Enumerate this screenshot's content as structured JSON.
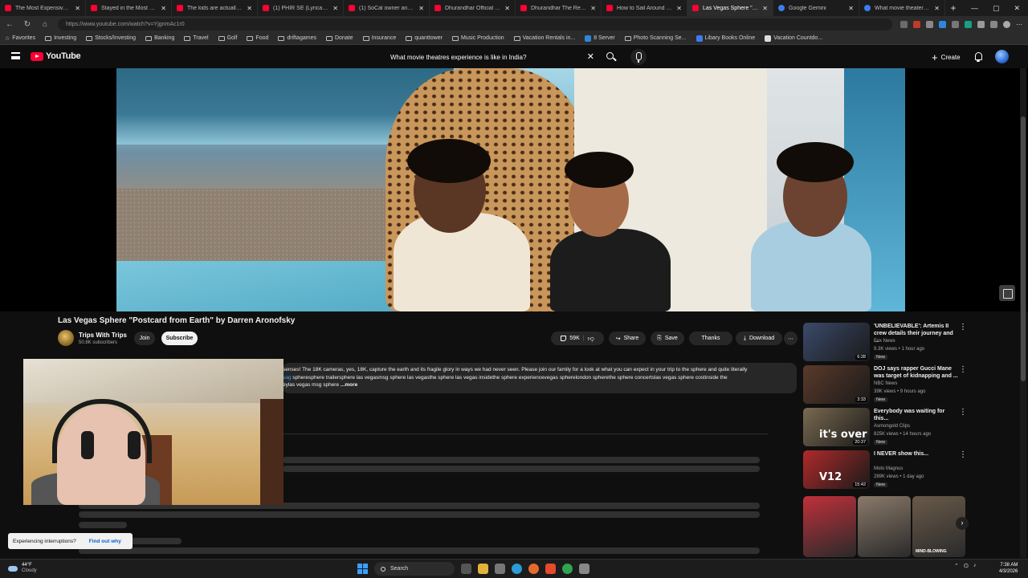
{
  "browser": {
    "tabs": [
      {
        "title": "The Most Expensive Mistak...",
        "favicon": "youtube-icon"
      },
      {
        "title": "Stayed in the Most Dangero...",
        "favicon": "youtube-icon"
      },
      {
        "title": "The kids are actually noticing...",
        "favicon": "youtube-icon"
      },
      {
        "title": "(1) PHIR SE (Lyrical) Dhuran...",
        "favicon": "youtube-icon"
      },
      {
        "title": "(1) SoCal owner and missing...",
        "favicon": "youtube-icon"
      },
      {
        "title": "Dhurandhar Official Trailer |...",
        "favicon": "youtube-icon"
      },
      {
        "title": "Dhurandhar The Revenge Of...",
        "favicon": "youtube-icon"
      },
      {
        "title": "How to Sail Around The Wo...",
        "favicon": "youtube-icon"
      },
      {
        "title": "Las Vegas Sphere \"Postcard...",
        "favicon": "youtube-icon",
        "active": true
      },
      {
        "title": "Google Gemini",
        "favicon": "gemini-icon"
      },
      {
        "title": "What movie theater experie...",
        "favicon": "google-icon"
      }
    ],
    "url": "https://www.youtube.com/watch?v=YjgnmAc1r0",
    "bookmarks": [
      "Favorites",
      "Investing",
      "Stocks/Investing",
      "Banking",
      "Travel",
      "Golf",
      "Food",
      "driftagames",
      "Donate",
      "Insurance",
      "quanttower",
      "Music Production",
      "Vacation Rentals in...",
      "8 Server",
      "Photo Scanning Se...",
      "Libary Books Online",
      "Vacation Countdo..."
    ]
  },
  "youtube": {
    "logo_text": "YouTube",
    "search_value": "What movie theatres experience is like in India?",
    "create_label": "Create",
    "video_title": "Las Vegas Sphere \"Postcard from Earth\" by Darren Aronofsky",
    "channel_name": "Trips With Trips",
    "channel_subs": "50.8K subscribers",
    "join_label": "Join",
    "subscribe_label": "Subscribe",
    "like_count": "59K",
    "share_label": "Share",
    "save_label": "Save",
    "thanks_label": "Thanks",
    "download_label": "Download",
    "description_line1": "senses! The 18K cameras, yes, 18K, capture the earth and its fragile glory in ways we had never seen. Please join our family for a look at what you can expect in your trip to the sphere and quite literally",
    "description_tags_lead": "sag",
    "description_line2": " spheresphere trailersphere las vegasmsg sphere las vegasthe sphere las vegas insidethe sphere experiencevegas spherelondon spherethe sphere concertslas vegas sphere costinside the",
    "description_line3": "eylas vegas msg sphere",
    "more_label": "...more"
  },
  "recommendations": [
    {
      "title": "'UNBELIEVABLE': Artemis II crew details their journey and ...",
      "channel": "Fox News",
      "meta": "9.3K views • 1 hour ago",
      "badge": "New",
      "duration": "6:28",
      "thumb_color": "#3a4a6a"
    },
    {
      "title": "DOJ says rapper Gucci Mane was target of kidnapping and ...",
      "channel": "NBC News",
      "meta": "39K views • 9 hours ago",
      "badge": "New",
      "duration": "3:33",
      "thumb_color": "#5a3a2a"
    },
    {
      "title": "Everybody was waiting for this...",
      "channel": "Asmongold Clips",
      "meta": "825K views • 14 hours ago",
      "badge": "New",
      "duration": "20:37",
      "thumb_color": "#7a6a50",
      "overlay": "it's over"
    },
    {
      "title": "I NEVER show this...",
      "channel": "Moto Magnus",
      "meta": "289K views • 1 day ago",
      "badge": "New",
      "duration": "15:42",
      "thumb_color": "#b02a2a",
      "overlay": "V12"
    }
  ],
  "shorts": [
    {
      "caption": "",
      "color": "#c0303a"
    },
    {
      "caption": "",
      "color": "#8a7a6a"
    },
    {
      "caption": "MIND-BLOWING",
      "color": "#6a5a4a"
    }
  ],
  "toast": {
    "text": "Experiencing interruptions?",
    "link": "Find out why"
  },
  "taskbar": {
    "temp": "44°F",
    "weather": "Cloudy",
    "search_label": "Search",
    "time": "7:38 AM",
    "date": "4/3/2026"
  }
}
